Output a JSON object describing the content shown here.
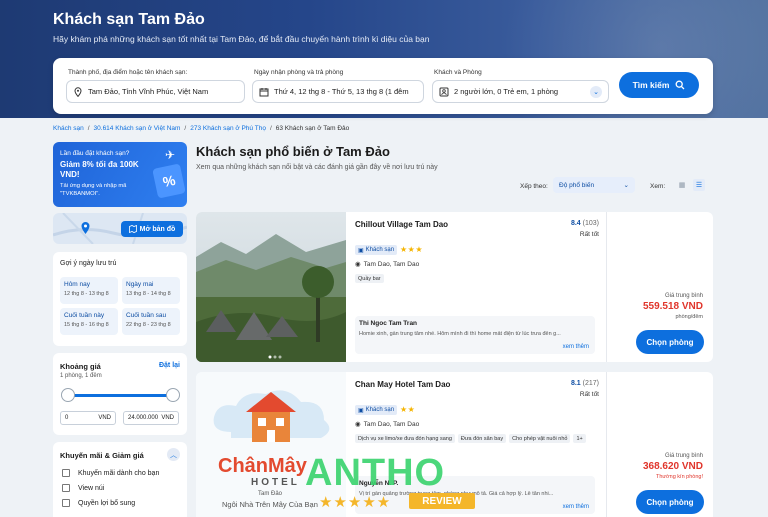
{
  "hero": {
    "title": "Khách sạn Tam Đảo",
    "subtitle": "Hãy khám phá những khách sạn tốt nhất tại Tam Đảo, để bắt đầu chuyến hành trình kì diệu của bạn"
  },
  "search": {
    "destination_label": "Thành phố, địa điểm hoặc tên khách sạn:",
    "destination_value": "Tam Đảo, Tỉnh Vĩnh Phúc, Việt Nam",
    "dates_label": "Ngày nhận phòng và trả phòng",
    "dates_value": "Thứ 4, 12 thg 8 - Thứ 5, 13 thg 8 (1 đêm",
    "guests_label": "Khách và Phòng",
    "guests_value": "2 người lớn, 0 Trẻ em, 1 phòng",
    "button_label": "Tìm kiếm"
  },
  "breadcrumb": [
    {
      "text": "Khách sạn",
      "sep": "/"
    },
    {
      "text": "30.614 Khách sạn ở Việt Nam",
      "sep": "/"
    },
    {
      "text": "273 Khách sạn ở Phú Thọ",
      "sep": "/"
    },
    {
      "text": "63 Khách sạn ở Tam Đảo",
      "sep": ""
    }
  ],
  "promo": {
    "line1": "Lần đầu đặt khách sạn?",
    "line2": "Giảm 8% tối đa 100K VND!",
    "line3": "Tải ứng dụng và nhập mã \"TVKBANMOI\".",
    "badge": "%"
  },
  "map": {
    "button_label": "Mở bản đồ"
  },
  "date_suggestions": {
    "title": "Gợi ý ngày lưu trú",
    "items": [
      {
        "label": "Hôm nay",
        "range": "12 thg 8 - 13 thg 8"
      },
      {
        "label": "Ngày mai",
        "range": "13 thg 8 - 14 thg 8"
      },
      {
        "label": "Cuối tuần này",
        "range": "15 thg 8 - 16 thg 8"
      },
      {
        "label": "Cuối tuần sau",
        "range": "22 thg 8 - 23 thg 8"
      }
    ]
  },
  "price_filter": {
    "title": "Khoảng giá",
    "sub": "1 phòng, 1 đêm",
    "reset": "Đặt lại",
    "min": "0",
    "max": "24.000.000",
    "currency": "VND"
  },
  "promo_filter": {
    "title": "Khuyến mãi & Giảm giá",
    "options": [
      "Khuyến mãi dành cho bạn",
      "View núi",
      "Quyền lợi bổ sung"
    ]
  },
  "listing": {
    "title": "Khách sạn phổ biến ở Tam Đảo",
    "subtitle": "Xem qua những khách sạn nổi bật và các đánh giá gần đây về nơi lưu trú này",
    "sort_label": "Xếp theo:",
    "sort_value": "Độ phổ biến",
    "view_label": "Xem:"
  },
  "hotels": [
    {
      "name": "Chillout Village Tam Dao",
      "score": "8.4",
      "count": "(103)",
      "rating_word": "Rất tốt",
      "type": "Khách sạn",
      "stars": "★★★",
      "location": "Tam Dao, Tam Dao",
      "tags": [
        "Quầy bar"
      ],
      "reviewer": "Thi Ngoc Tam Tran",
      "review": "Homie xinh, gần trung tâm nhé. Hôm mình đi thì home mất điện từ lúc trưa đến g...",
      "see_more": "xem thêm",
      "price_label": "Giá trung bình",
      "price": "559.518 VND",
      "per": "phòng/đêm",
      "note": "",
      "cta": "Chọn phòng"
    },
    {
      "name": "Chan May Hotel Tam Dao",
      "score": "8.1",
      "count": "(217)",
      "rating_word": "Rất tốt",
      "type": "Khách sạn",
      "stars": "★★",
      "location": "Tam Dao, Tam Dao",
      "tags": [
        "Dịch vụ xe limo/xe đưa đón hạng sang",
        "Đưa đón sân bay",
        "Cho phép vật nuôi nhỏ",
        "1+"
      ],
      "reviewer": "Nguyễn N. P.",
      "review": "Vị trí gần quảng trường trung tâm, phòng như mô tả. Giá cả hợp lý. Lễ tân nhi...",
      "see_more": "xem thêm",
      "price_label": "Giá trung bình",
      "price": "368.620 VND",
      "per": "",
      "note": "Thường kín phòng!",
      "cta": "Chọn phòng"
    }
  ],
  "hotel2_logo": {
    "brand": "ChânMây",
    "hotel": "HOTEL",
    "place": "Tam Đảo",
    "tagline": "Ngôi Nhà Trên Mây Của Bạn"
  },
  "watermark": {
    "text": "ANTHO",
    "badge": "REVIEW",
    "stars": "★★★★★"
  },
  "colors": {
    "primary": "#0d6fde",
    "price": "#e0352b",
    "hero": "#1e3a73",
    "star": "#f5b400"
  }
}
